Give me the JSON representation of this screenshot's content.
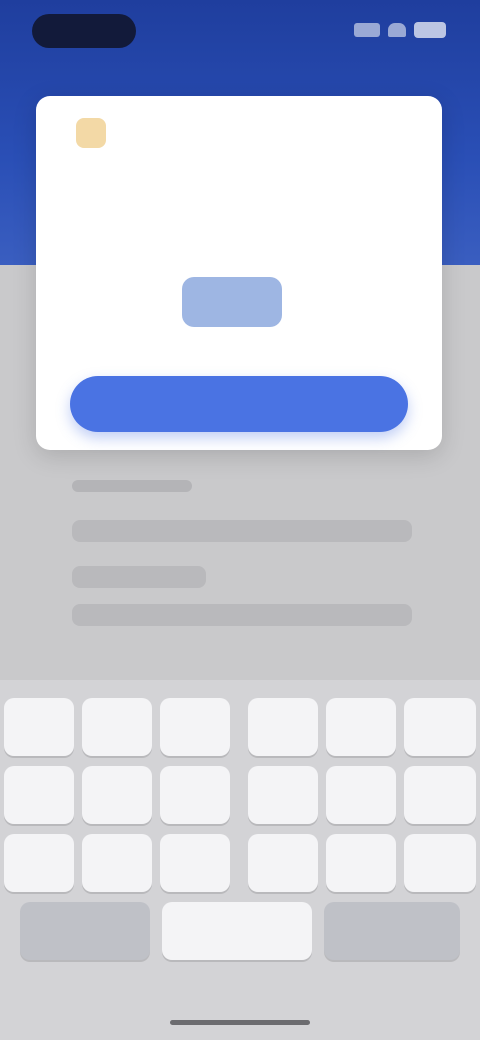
{
  "status_bar": {
    "time": "",
    "signal_icon": "signal-icon",
    "wifi_icon": "wifi-icon",
    "battery_icon": "battery-icon"
  },
  "dialog": {
    "title": "",
    "prompt": "",
    "code_value": "",
    "code_placeholder": "",
    "code_unit": "",
    "confirm_label": "",
    "logo_icon": "app-logo-icon"
  },
  "background": {
    "section_heading": "",
    "rows": [
      "",
      "",
      ""
    ]
  },
  "keyboard": {
    "rows": [
      [
        "",
        "",
        "",
        "",
        "",
        ""
      ],
      [
        "",
        "",
        "",
        "",
        "",
        ""
      ],
      [
        "",
        "",
        "",
        "",
        "",
        ""
      ],
      [
        "",
        "",
        ""
      ]
    ]
  },
  "colors": {
    "header_blue": "#2a4fb6",
    "accent": "#4a73e3",
    "input_fill": "#9eb6e3",
    "page_gray": "#c9c9cb",
    "keyboard_gray": "#d3d3d6"
  }
}
